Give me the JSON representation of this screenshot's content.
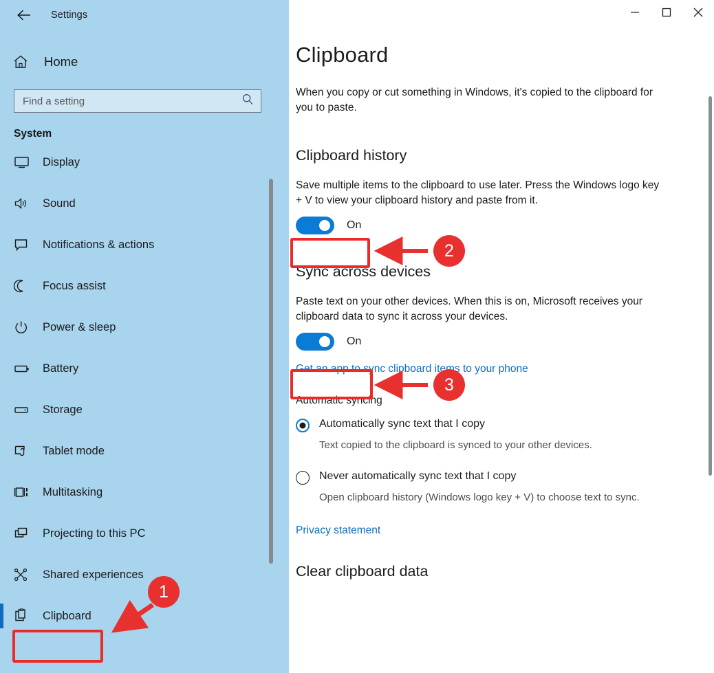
{
  "window": {
    "app_title": "Settings",
    "back_icon": "back-arrow-icon",
    "minimize_label": "─",
    "maximize_label": "□",
    "close_label": "✕"
  },
  "sidebar": {
    "home_label": "Home",
    "home_icon": "home-icon",
    "search": {
      "placeholder": "Find a setting",
      "value": "",
      "icon": "search-icon"
    },
    "section_title": "System",
    "items": [
      {
        "label": "Display",
        "icon": "monitor-icon",
        "selected": false
      },
      {
        "label": "Sound",
        "icon": "speaker-icon",
        "selected": false
      },
      {
        "label": "Notifications & actions",
        "icon": "chat-bubble-icon",
        "selected": false
      },
      {
        "label": "Focus assist",
        "icon": "moon-icon",
        "selected": false
      },
      {
        "label": "Power & sleep",
        "icon": "power-icon",
        "selected": false
      },
      {
        "label": "Battery",
        "icon": "battery-icon",
        "selected": false
      },
      {
        "label": "Storage",
        "icon": "drive-icon",
        "selected": false
      },
      {
        "label": "Tablet mode",
        "icon": "tablet-icon",
        "selected": false
      },
      {
        "label": "Multitasking",
        "icon": "multitasking-icon",
        "selected": false
      },
      {
        "label": "Projecting to this PC",
        "icon": "project-screen-icon",
        "selected": false
      },
      {
        "label": "Shared experiences",
        "icon": "share-nodes-icon",
        "selected": false
      },
      {
        "label": "Clipboard",
        "icon": "clipboard-icon",
        "selected": true
      }
    ]
  },
  "main": {
    "page_title": "Clipboard",
    "intro": "When you copy or cut something in Windows, it's copied to the clipboard for you to paste.",
    "clipboard_history": {
      "heading": "Clipboard history",
      "description": "Save multiple items to the clipboard to use later. Press the Windows logo key + V to view your clipboard history and paste from it.",
      "toggle_state": "On"
    },
    "sync_across_devices": {
      "heading": "Sync across devices",
      "description": "Paste text on your other devices. When this is on, Microsoft receives your clipboard data to sync it across your devices.",
      "toggle_state": "On",
      "link": "Get an app to sync clipboard items to your phone",
      "automatic_syncing_label": "Automatic syncing",
      "options": [
        {
          "label": "Automatically sync text that I copy",
          "description": "Text copied to the clipboard is synced to your other devices.",
          "selected": true
        },
        {
          "label": "Never automatically sync text that I copy",
          "description": "Open clipboard history (Windows logo key + V) to choose text to sync.",
          "selected": false
        }
      ],
      "privacy_link": "Privacy statement"
    },
    "clear_clipboard_data": {
      "heading": "Clear clipboard data"
    }
  },
  "annotations": {
    "accent_red": "#e8302f",
    "badges": [
      {
        "number": "1",
        "target": "sidebar-item-clipboard"
      },
      {
        "number": "2",
        "target": "clipboard-history-toggle"
      },
      {
        "number": "3",
        "target": "sync-across-devices-toggle"
      }
    ]
  },
  "colors": {
    "sidebar_bg": "#a8d4ee",
    "toggle_on": "#0a7cd6",
    "link": "#0e6cbf",
    "accent_selected": "#0f6cbd"
  }
}
